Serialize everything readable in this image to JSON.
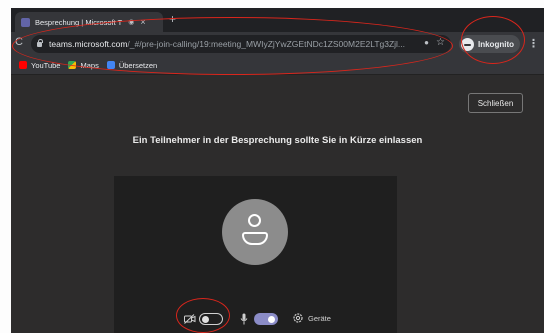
{
  "browser": {
    "tab": {
      "title": "Besprechung | Microsoft T",
      "sound_icon": "speaker-icon",
      "close_icon": "close-icon"
    },
    "new_tab_icon": "plus-icon",
    "url_host": "teams.microsoft.com",
    "url_path": "/_#/pre-join-calling/19:meeting_MWIyZjYwZGEtNDc1ZS00M2E2LTg3Zjl...",
    "profile_label": "Inkognito",
    "bookmarks": [
      {
        "label": "YouTube",
        "icon": "youtube-icon"
      },
      {
        "label": "Maps",
        "icon": "maps-icon"
      },
      {
        "label": "Übersetzen",
        "icon": "translate-icon"
      }
    ]
  },
  "page": {
    "close_label": "Schließen",
    "waiting_message": "Ein Teilnehmer in der Besprechung sollte Sie in Kürze einlassen",
    "devices_label": "Geräte",
    "camera_enabled": false,
    "mic_enabled": true
  },
  "colors": {
    "accent": "#8b8cc7",
    "annotation": "#d9261c",
    "page_bg": "#2d2c2c"
  }
}
